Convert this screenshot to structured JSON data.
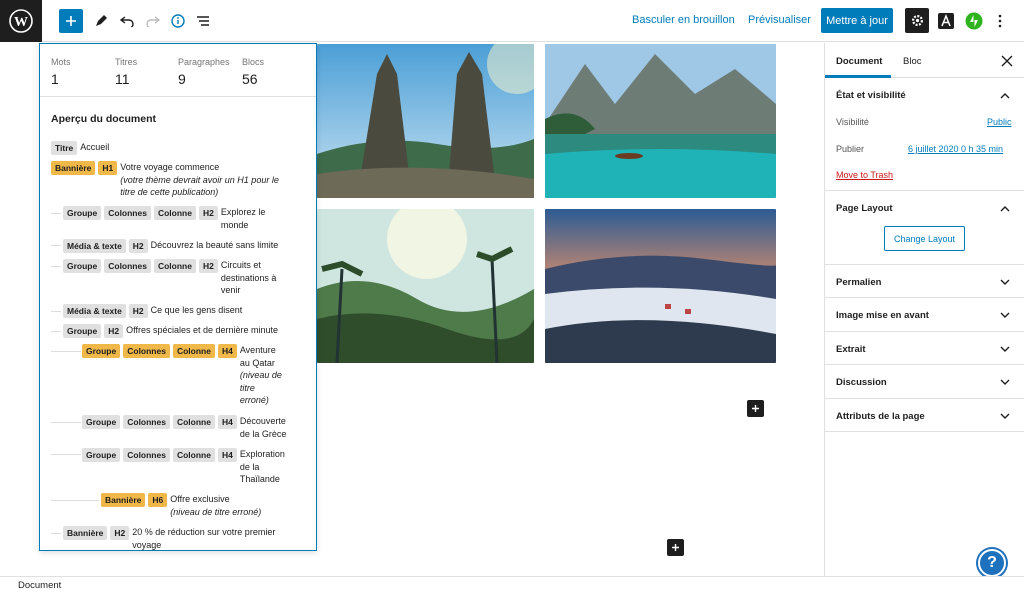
{
  "topbar": {
    "switch_draft": "Basculer en brouillon",
    "preview": "Prévisualiser",
    "update": "Mettre à jour"
  },
  "stats": [
    {
      "label": "Mots",
      "value": "1"
    },
    {
      "label": "Titres",
      "value": "11"
    },
    {
      "label": "Paragraphes",
      "value": "9"
    },
    {
      "label": "Blocs",
      "value": "56"
    }
  ],
  "overview": {
    "title": "Aperçu du document",
    "rows": [
      {
        "tags": [
          "Titre"
        ],
        "text": "Accueil"
      },
      {
        "tags": [
          "Bannière",
          "H1"
        ],
        "text": "Votre voyage commence",
        "note": "(votre thème devrait avoir un H1 pour le titre de cette publication)"
      },
      {
        "tags": [
          "Groupe",
          "Colonnes",
          "Colonne",
          "H2"
        ],
        "text": "Explorez le monde"
      },
      {
        "tags": [
          "Média & texte",
          "H2"
        ],
        "text": "Découvrez la beauté sans limite"
      },
      {
        "tags": [
          "Groupe",
          "Colonnes",
          "Colonne",
          "H2"
        ],
        "text": "Circuits et destinations à venir"
      },
      {
        "tags": [
          "Média & texte",
          "H2"
        ],
        "text": "Ce que les gens disent"
      },
      {
        "tags": [
          "Groupe",
          "H2"
        ],
        "text": "Offres spéciales et de dernière minute"
      },
      {
        "tags": [
          "Groupe",
          "Colonnes",
          "Colonne",
          "H4"
        ],
        "text": "Aventure au Qatar",
        "note": "(niveau de titre erroné)"
      },
      {
        "tags": [
          "Groupe",
          "Colonnes",
          "Colonne",
          "H4"
        ],
        "text": "Découverte de la Grèce"
      },
      {
        "tags": [
          "Groupe",
          "Colonnes",
          "Colonne",
          "H4"
        ],
        "text": "Exploration de la Thaïlande"
      },
      {
        "tags": [
          "Bannière",
          "H6"
        ],
        "text": "Offre exclusive",
        "note": "(niveau de titre erroné)"
      },
      {
        "tags": [
          "Bannière",
          "H2"
        ],
        "text": "20 % de réduction sur votre premier voyage"
      }
    ]
  },
  "sidebar": {
    "tab_document": "Document",
    "tab_block": "Bloc",
    "status_title": "État et visibilité",
    "visibility_label": "Visibilité",
    "visibility_value": "Public",
    "publish_label": "Publier",
    "publish_value": "6 juillet 2020 0 h 35 min",
    "trash": "Move to Trash",
    "page_layout": "Page Layout",
    "change_layout": "Change Layout",
    "permalink": "Permalien",
    "featured_image": "Image mise en avant",
    "excerpt": "Extrait",
    "discussion": "Discussion",
    "page_attributes": "Attributs de la page"
  },
  "statusbar": {
    "breadcrumb": "Document"
  },
  "colors": {
    "accent": "#007cba",
    "warning_tag": "#f0b849",
    "trash": "#cc1818"
  }
}
